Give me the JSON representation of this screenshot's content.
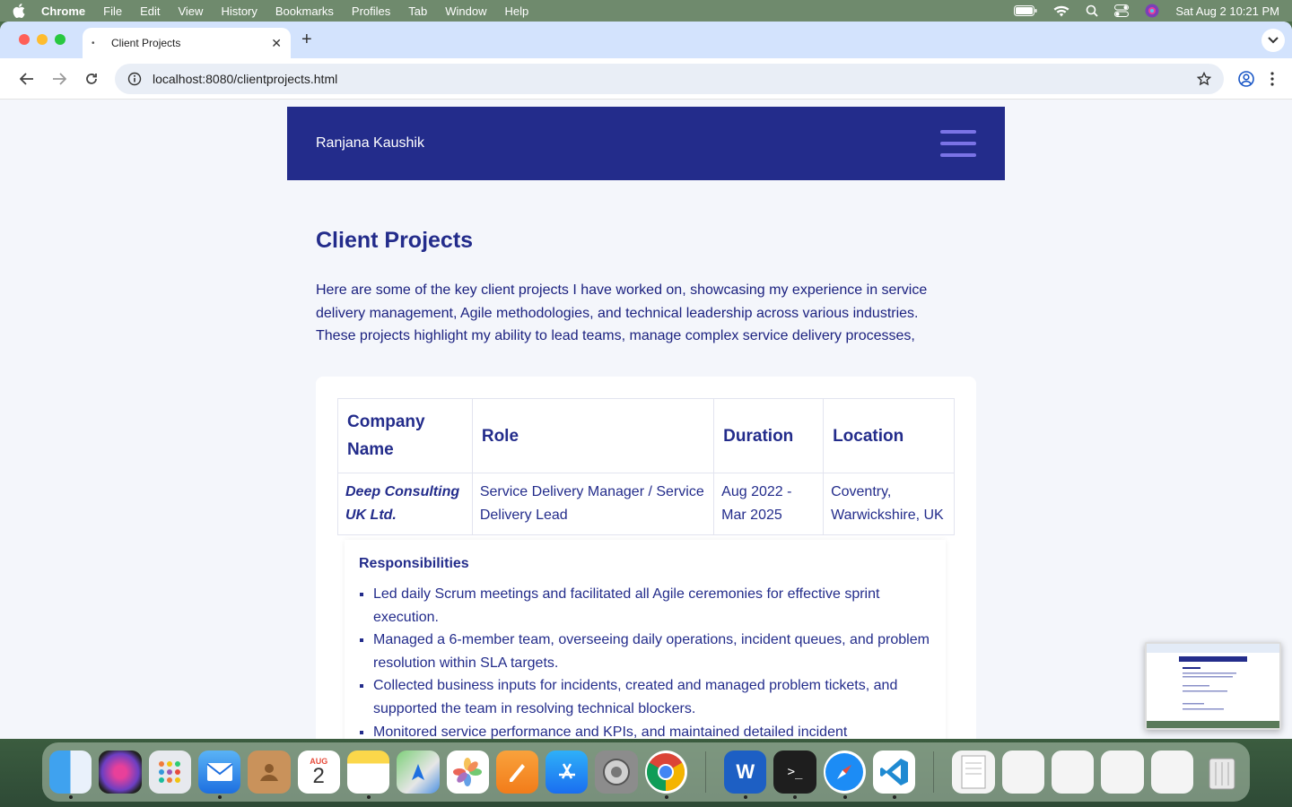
{
  "menubar": {
    "app": "Chrome",
    "items": [
      "File",
      "Edit",
      "View",
      "History",
      "Bookmarks",
      "Profiles",
      "Tab",
      "Window",
      "Help"
    ],
    "datetime": "Sat Aug 2  10:21 PM"
  },
  "browser": {
    "tab_title": "Client Projects",
    "url": "localhost:8080/clientprojects.html"
  },
  "site": {
    "name": "Ranjana Kaushik"
  },
  "page": {
    "title": "Client Projects",
    "intro": "Here are some of the key client projects I have worked on, showcasing my experience in service delivery management, Agile methodologies, and technical leadership across various industries. These projects highlight my ability to lead teams, manage complex service delivery processes,"
  },
  "table": {
    "headers": [
      "Company Name",
      "Role",
      "Duration",
      "Location"
    ],
    "rows": [
      [
        "Deep Consulting UK Ltd.",
        "Service Delivery Manager / Service Delivery Lead",
        "Aug 2022 - Mar 2025",
        "Coventry, Warwickshire, UK"
      ]
    ]
  },
  "responsibilities": {
    "title": "Responsibilities",
    "items": [
      "Led daily Scrum meetings and facilitated all Agile ceremonies for effective sprint execution.",
      "Managed a 6-member team, overseeing daily operations, incident queues, and problem resolution within SLA targets.",
      "Collected business inputs for incidents, created and managed problem tickets, and supported the team in resolving technical blockers.",
      "Monitored service performance and KPIs, and maintained detailed incident"
    ]
  },
  "dock": {
    "calendar_month": "AUG",
    "calendar_day": "2",
    "apps": [
      "Finder",
      "Siri",
      "Launchpad",
      "Mail",
      "Contacts",
      "Calendar",
      "Notes",
      "Maps",
      "Photos",
      "Pages",
      "App Store",
      "System Settings",
      "Chrome",
      "Word",
      "Terminal",
      "Safari",
      "VS Code"
    ]
  },
  "colors": {
    "header_bg": "#232c8b",
    "accent": "#7a73e6",
    "text": "#232c8b"
  }
}
